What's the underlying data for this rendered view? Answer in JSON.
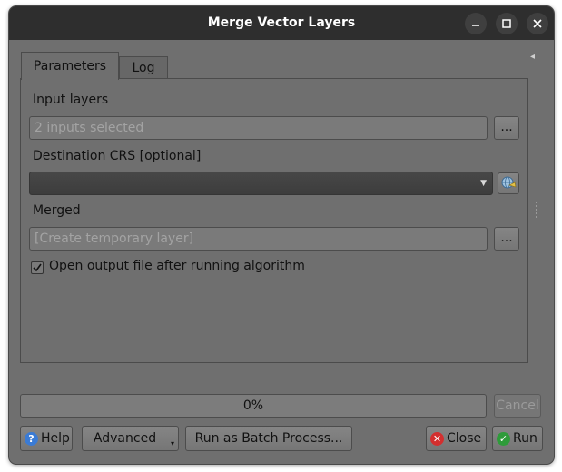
{
  "window": {
    "title": "Merge Vector Layers"
  },
  "titlebar_buttons": {
    "minimize_icon": "minimize-icon",
    "maximize_icon": "maximize-icon",
    "close_icon": "close-icon"
  },
  "tabs": [
    {
      "label": "Parameters"
    },
    {
      "label": "Log"
    }
  ],
  "collapse_glyph": "◂",
  "params": {
    "input_layers": {
      "label": "Input layers",
      "value": "2 inputs selected",
      "button": "..."
    },
    "destination_crs": {
      "label": "Destination CRS [optional]",
      "value": ""
    },
    "merged": {
      "label": "Merged",
      "placeholder": "[Create temporary layer]",
      "button": "..."
    },
    "open_output": {
      "label": "Open output file after running algorithm",
      "checked": true
    }
  },
  "progress": {
    "text": "0%",
    "fraction": 0
  },
  "buttons": {
    "cancel": "Cancel",
    "help": "Help",
    "advanced": "Advanced",
    "batch": "Run as Batch Process...",
    "close": "Close",
    "run": "Run"
  },
  "colors": {
    "help_icon": "#3a7bd5",
    "close_icon": "#d32f2f",
    "run_icon": "#2e9b3a",
    "titlebar": "#2e2e2e",
    "window_bg": "#6f6f6f"
  }
}
